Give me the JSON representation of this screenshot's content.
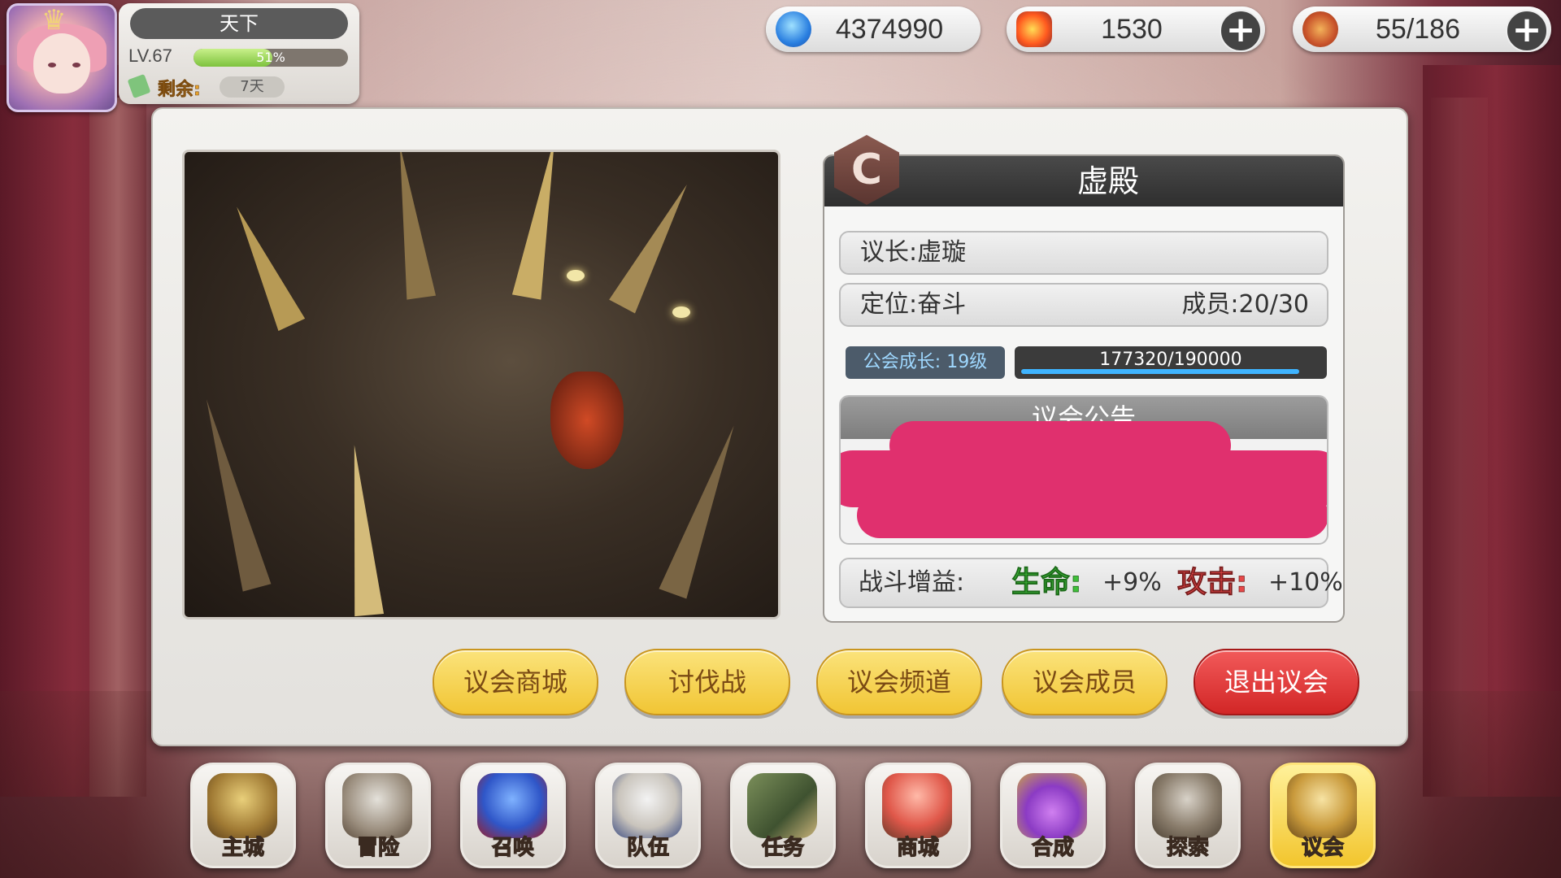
{
  "player": {
    "name": "天下",
    "level_label": "LV.67",
    "xp_percent_text": "51%",
    "xp_fraction": 0.51,
    "remain_label": "剩余:",
    "remain_value": "7天"
  },
  "currencies": [
    {
      "icon": "blue-flame-gem-icon",
      "value": "4374990",
      "has_plus": false
    },
    {
      "icon": "fire-crest-icon",
      "value": "1530",
      "has_plus": true
    },
    {
      "icon": "hotdog-stamina-icon",
      "value": "55/186",
      "has_plus": true
    }
  ],
  "guild": {
    "rank": "C",
    "name": "虚殿",
    "leader_label": "议长:虚璇",
    "position_label": "定位:奋斗",
    "members_label": "成员:20/30",
    "growth_label": "公会成长: 19级",
    "growth_progress_text": "177320/190000",
    "growth_fraction": 0.9333,
    "notice_title": "议会公告",
    "buff_label": "战斗增益:",
    "hp_label": "生命:",
    "hp_value": "+9%",
    "atk_label": "攻击:",
    "atk_value": "+10%"
  },
  "buttons": {
    "shop": "议会商城",
    "crusade": "讨伐战",
    "channel": "议会频道",
    "members": "议会成员",
    "leave": "退出议会"
  },
  "nav": [
    {
      "label": "主城",
      "icon": "crown-castle-icon"
    },
    {
      "label": "冒险",
      "icon": "crossed-swords-icon"
    },
    {
      "label": "召唤",
      "icon": "summon-card-icon"
    },
    {
      "label": "队伍",
      "icon": "winged-emblem-icon"
    },
    {
      "label": "任务",
      "icon": "quest-book-icon"
    },
    {
      "label": "商城",
      "icon": "shop-tree-icon"
    },
    {
      "label": "合成",
      "icon": "potion-flask-icon"
    },
    {
      "label": "探索",
      "icon": "shovel-icon"
    },
    {
      "label": "议会",
      "icon": "guild-crest-icon",
      "active": true
    }
  ],
  "colors": {
    "accent_yellow": "#f1c534",
    "leave_red": "#d22626",
    "hp_green": "#3fbf3a",
    "atk_red": "#e64848",
    "censor_pink": "#e0306e"
  }
}
